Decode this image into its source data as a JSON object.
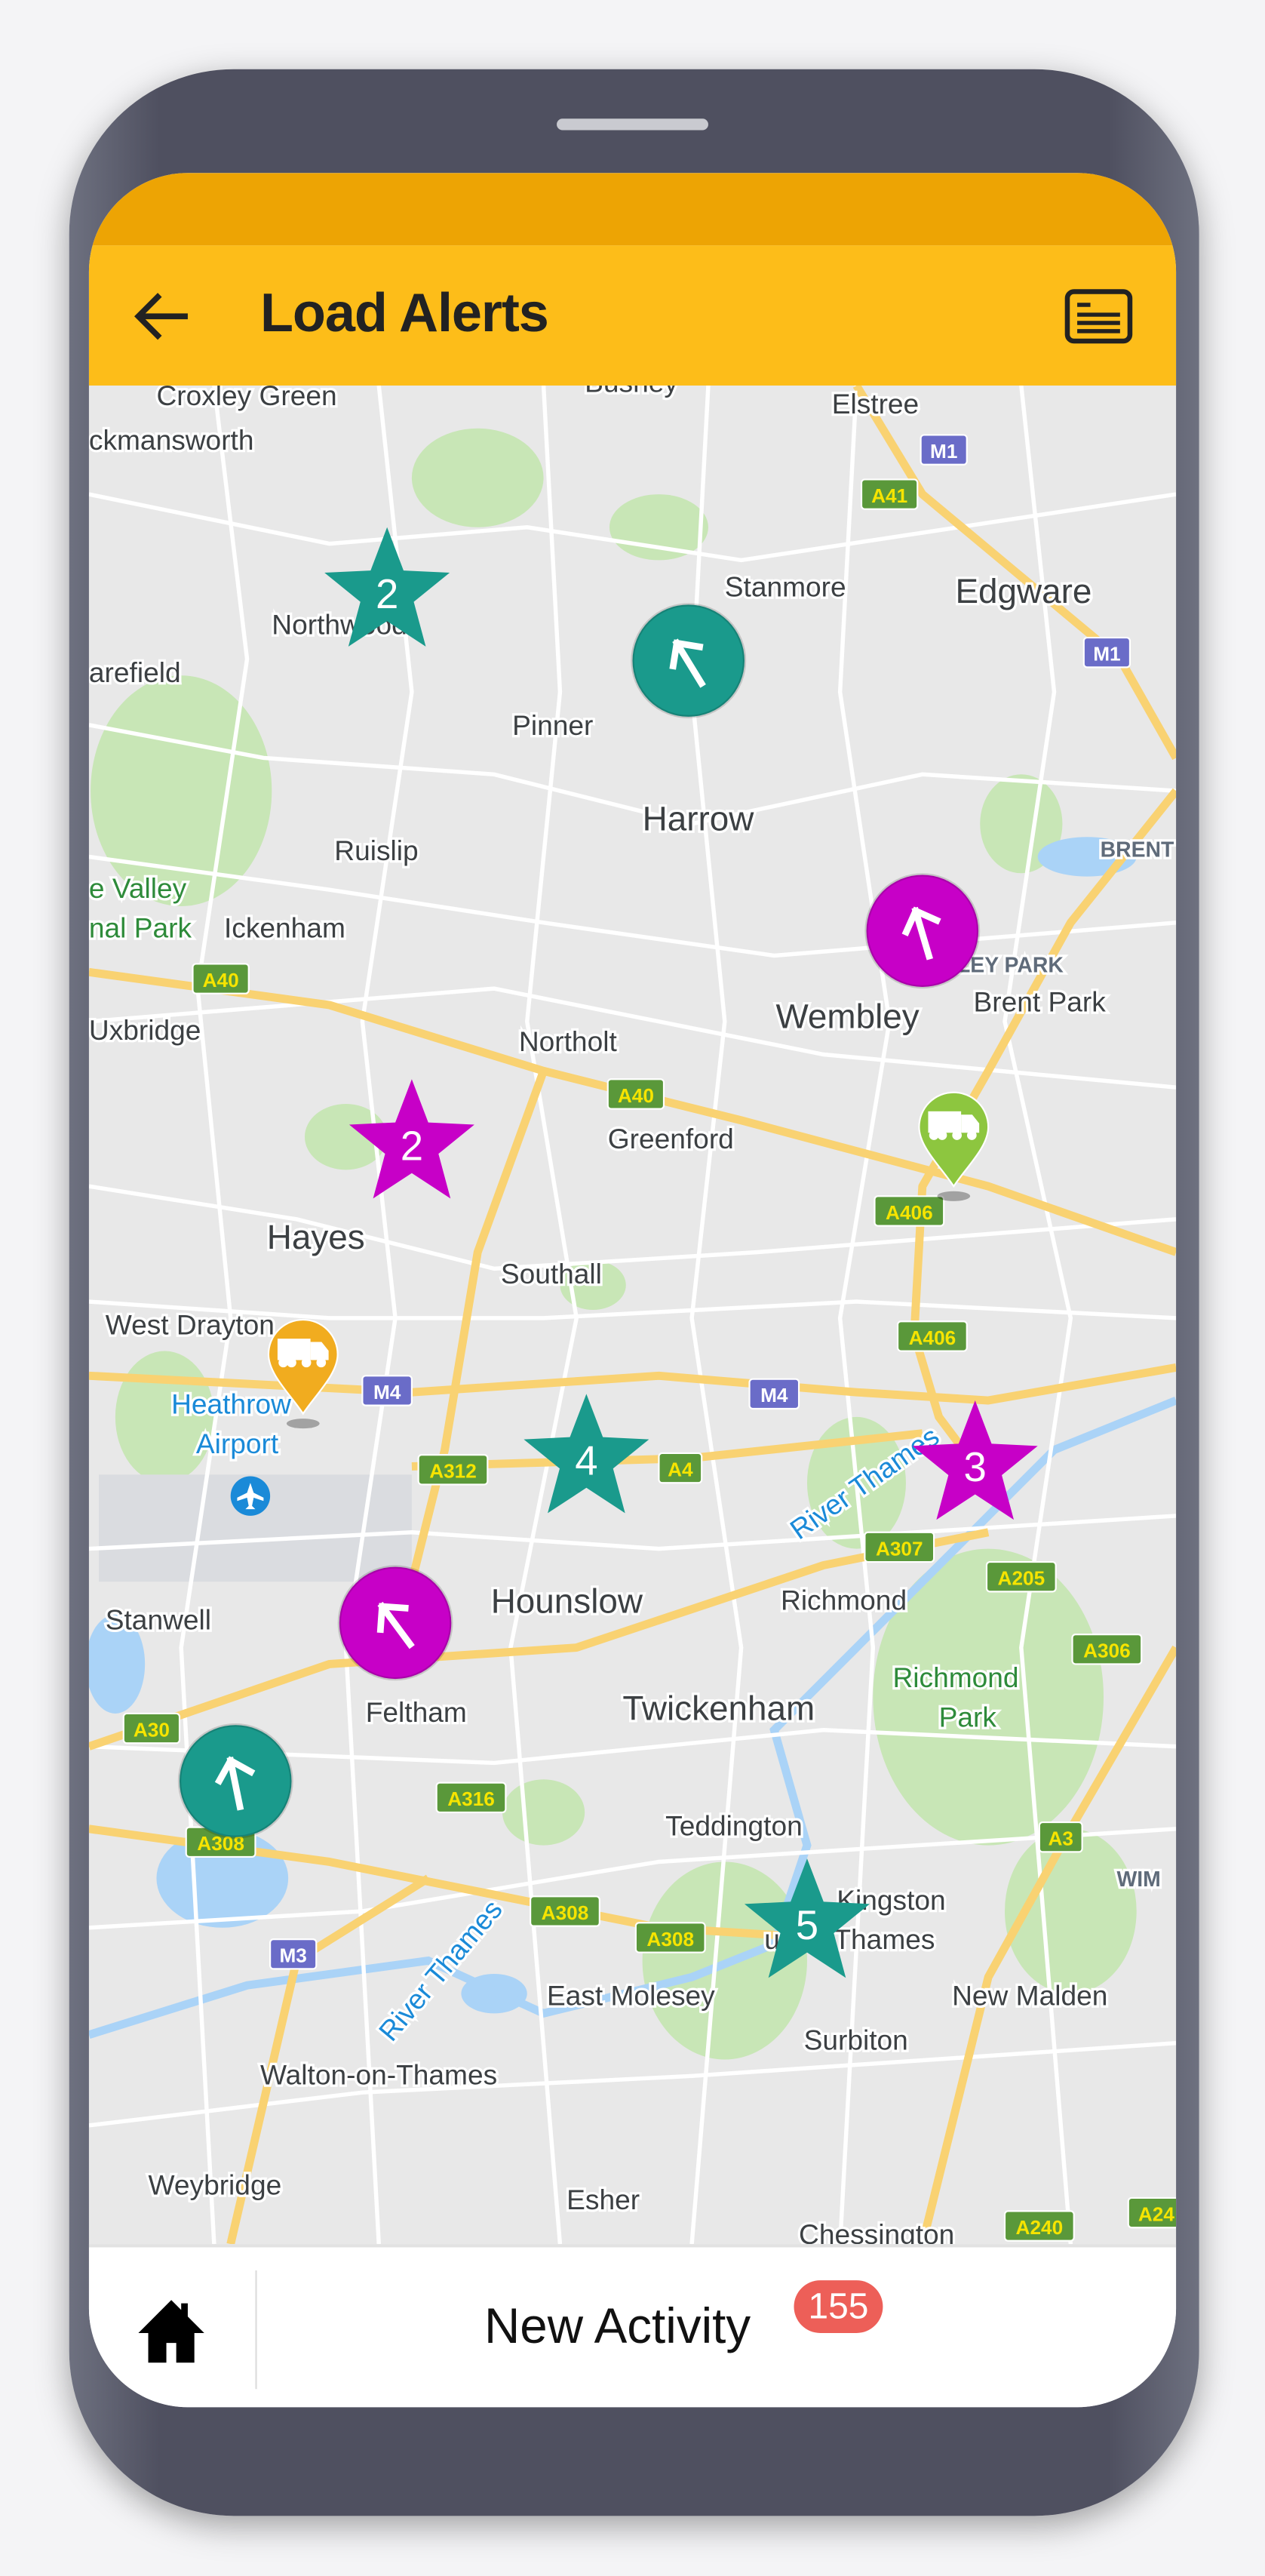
{
  "header": {
    "title": "Load Alerts",
    "back_icon": "arrow-left-icon",
    "menu_icon": "list-icon"
  },
  "colors": {
    "status_bar": "#eda404",
    "toolbar": "#fdbd19",
    "teal": "#1a9a8c",
    "magenta": "#c700c7",
    "badge": "#ed5f58"
  },
  "map": {
    "places": [
      "Croxley Green",
      "Bushey",
      "Elstree",
      "ckmansworth",
      "Stanmore",
      "Edgware",
      "Northwood",
      "arefield",
      "Pinner",
      "Harrow",
      "Ruislip",
      "e Valley",
      "nal Park",
      "Ickenham",
      "WEMBLEY PARK",
      "Wembley",
      "Brent Park",
      "BRENT",
      "Uxbridge",
      "Northolt",
      "Greenford",
      "Hayes",
      "Southall",
      "West Drayton",
      "Heathrow",
      "Airport",
      "Hounslow",
      "Richmond",
      "Stanwell",
      "Richmond",
      "Park",
      "Feltham",
      "Twickenham",
      "Teddington",
      "Kingston",
      "upon Thames",
      "East Molesey",
      "New Malden",
      "Surbiton",
      "Walton-on-Thames",
      "Weybridge",
      "Esher",
      "Chessington",
      "WIM",
      "River Thames",
      "River Thames"
    ],
    "roads": [
      "M1",
      "A41",
      "M1",
      "A40",
      "A40",
      "A406",
      "A406",
      "M4",
      "M4",
      "A312",
      "A4",
      "A307",
      "A205",
      "A306",
      "A30",
      "A316",
      "A308",
      "A3",
      "A308",
      "A308",
      "M3",
      "A240",
      "A24"
    ],
    "markers": [
      {
        "type": "star",
        "color": "teal",
        "label": "2"
      },
      {
        "type": "circle",
        "color": "teal",
        "icon": "arrow-icon"
      },
      {
        "type": "circle",
        "color": "magenta",
        "icon": "arrow-icon"
      },
      {
        "type": "pin",
        "color": "green",
        "icon": "truck-icon"
      },
      {
        "type": "star",
        "color": "magenta",
        "label": "2"
      },
      {
        "type": "pin",
        "color": "orange",
        "icon": "truck-icon"
      },
      {
        "type": "star",
        "color": "teal",
        "label": "4"
      },
      {
        "type": "star",
        "color": "magenta",
        "label": "3"
      },
      {
        "type": "circle",
        "color": "magenta",
        "icon": "arrow-icon"
      },
      {
        "type": "circle",
        "color": "teal",
        "icon": "arrow-icon"
      },
      {
        "type": "star",
        "color": "teal",
        "label": "5"
      }
    ]
  },
  "bottom": {
    "home_icon": "home-icon",
    "new_activity": "New Activity",
    "badge_count": "155"
  }
}
